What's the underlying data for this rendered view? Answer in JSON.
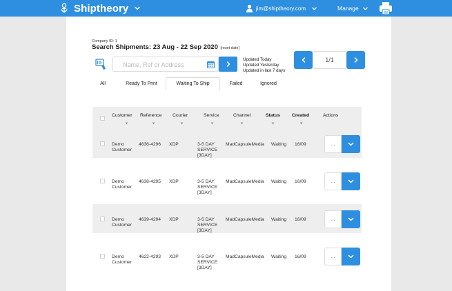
{
  "header": {
    "brand": "Shiptheory",
    "user_email": "jim@shiptheory.com",
    "manage_label": "Manage",
    "icons": [
      "logo-icon",
      "chevron-down-icon",
      "user-icon",
      "printer-icon"
    ]
  },
  "page": {
    "company_id": "Company ID: 1",
    "title": "Search Shipments: 23 Aug - 22 Sep 2020",
    "reset_label": "[reset date]"
  },
  "search": {
    "placeholder": "Name, Ref or Address",
    "value": "",
    "quick_links": [
      "Updated Today",
      "Updated Yesterday",
      "Updated in last 7 days"
    ]
  },
  "pagination": {
    "label": "1/1"
  },
  "tabs": [
    {
      "label": "All",
      "active": false
    },
    {
      "label": "Ready To Print",
      "active": false
    },
    {
      "label": "Waiting To Ship",
      "active": true
    },
    {
      "label": "Failed",
      "active": false
    },
    {
      "label": "Ignored",
      "active": false
    }
  ],
  "table": {
    "columns": [
      "Customer",
      "Reference",
      "Courier",
      "Service",
      "Channel",
      "Status",
      "Created",
      "Actions"
    ],
    "rows": [
      {
        "customer": [
          "Demo",
          "Customer"
        ],
        "reference": "4636-4296",
        "courier": "XDP",
        "service": [
          "3-5 DAY",
          "SERVICE",
          "[3DAY]"
        ],
        "channel": "MadCapsuleMedia",
        "status": "Waiting",
        "created": "16/09",
        "more": "..."
      },
      {
        "customer": [
          "Demo",
          "Customer"
        ],
        "reference": "4638-4295",
        "courier": "XDP",
        "service": [
          "3-5 DAY",
          "SERVICE",
          "[3DAY]"
        ],
        "channel": "MadCapsuleMedia",
        "status": "Waiting",
        "created": "16/09",
        "more": "..."
      },
      {
        "customer": [
          "Demo",
          "Customer"
        ],
        "reference": "4639-4294",
        "courier": "XDP",
        "service": [
          "3-5 DAY",
          "SERVICE",
          "[3DAY]"
        ],
        "channel": "MadCapsuleMedia",
        "status": "Waiting",
        "created": "16/09",
        "more": "..."
      },
      {
        "customer": [
          "Demo",
          "Customer"
        ],
        "reference": "4622-4293",
        "courier": "XDP",
        "service": [
          "3-5 DAY",
          "SERVICE",
          "[3DAY]"
        ],
        "channel": "MadCapsuleMedia",
        "status": "Waiting",
        "created": "16/09",
        "more": "..."
      }
    ]
  },
  "colors": {
    "primary": "#2e8fe0",
    "row_alt": "#eeeeee",
    "background": "#e9e9e9"
  }
}
